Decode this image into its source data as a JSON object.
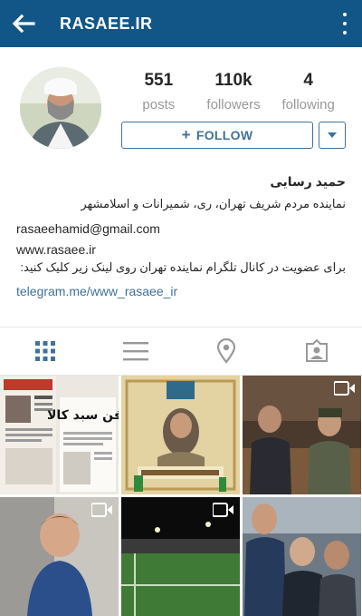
{
  "topbar": {
    "title": "RASAEE.IR",
    "back_icon": "back-arrow-icon",
    "menu_icon": "kebab-menu-icon",
    "bg_color": "#125688"
  },
  "stats": {
    "posts": {
      "value": "551",
      "label": "posts"
    },
    "followers": {
      "value": "110k",
      "label": "followers"
    },
    "following": {
      "value": "4",
      "label": "following"
    }
  },
  "actions": {
    "follow_label": "FOLLOW",
    "follow_icon": "plus-icon",
    "dropdown_icon": "caret-down-icon",
    "accent_color": "#3f729b"
  },
  "bio": {
    "name": "حمید رسایی",
    "line1": "نماینده مردم شریف تهران، ری، شمیرانات و اسلامشهر",
    "email": "rasaeehamid@gmail.com",
    "website": "www.rasaee.ir",
    "line2": "برای عضویت در کانال تلگرام نماینده تهران روی لینک زیر کلیک کنید:",
    "telegram": "telegram.me/www_rasaee_ir"
  },
  "tabs": [
    {
      "name": "grid-view",
      "icon": "grid-icon",
      "active": true
    },
    {
      "name": "list-view",
      "icon": "list-icon",
      "active": false
    },
    {
      "name": "places",
      "icon": "location-pin-icon",
      "active": false
    },
    {
      "name": "tagged",
      "icon": "tagged-photo-icon",
      "active": false
    }
  ],
  "grid": {
    "posts": [
      {
        "kind": "newspaper",
        "text": "دفن سبد کالا",
        "is_video": false
      },
      {
        "kind": "poster",
        "is_video": false
      },
      {
        "kind": "parliament-scene",
        "is_video": true
      },
      {
        "kind": "child-photo",
        "is_video": true
      },
      {
        "kind": "stadium-photo",
        "is_video": true
      },
      {
        "kind": "crowd-photo",
        "is_video": false
      }
    ]
  }
}
